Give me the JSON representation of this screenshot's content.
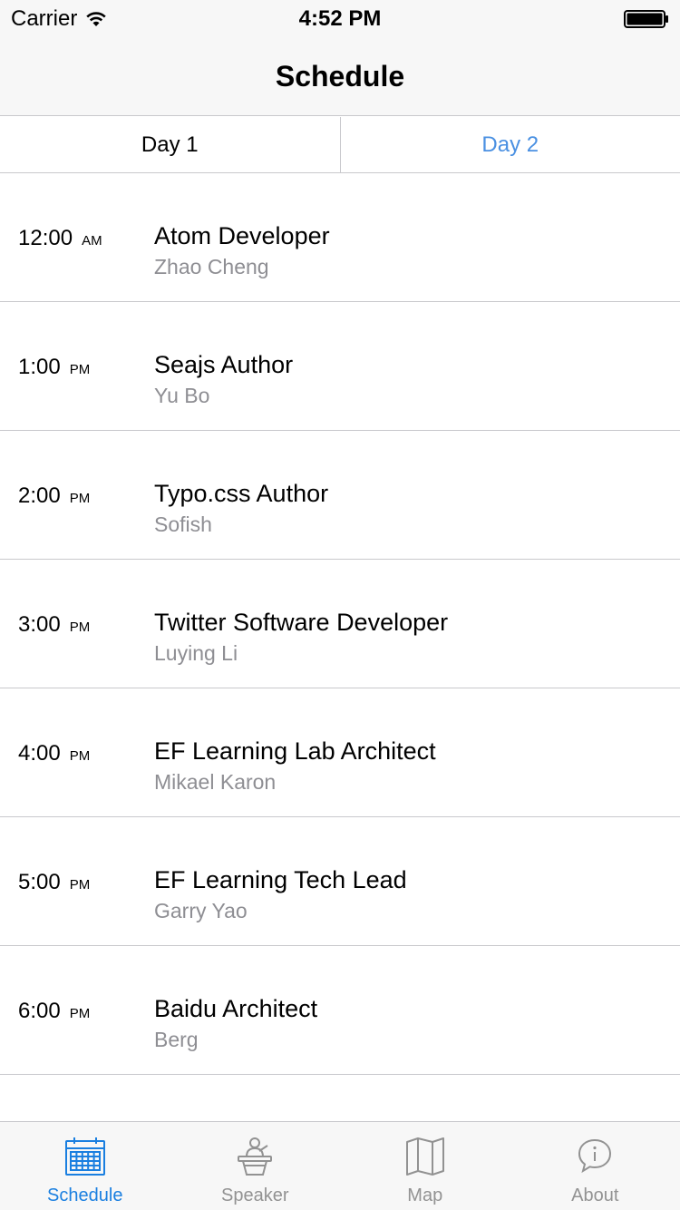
{
  "status": {
    "carrier": "Carrier",
    "time": "4:52 PM"
  },
  "nav": {
    "title": "Schedule"
  },
  "day_tabs": [
    {
      "label": "Day 1",
      "selected": true
    },
    {
      "label": "Day 2",
      "selected": false
    }
  ],
  "schedule": [
    {
      "time": "12:00",
      "period": "AM",
      "title": "Atom Developer",
      "speaker": "Zhao Cheng"
    },
    {
      "time": "1:00",
      "period": "PM",
      "title": "Seajs Author",
      "speaker": "Yu Bo"
    },
    {
      "time": "2:00",
      "period": "PM",
      "title": "Typo.css Author",
      "speaker": "Sofish"
    },
    {
      "time": "3:00",
      "period": "PM",
      "title": "Twitter Software Developer",
      "speaker": "Luying Li"
    },
    {
      "time": "4:00",
      "period": "PM",
      "title": "EF Learning Lab Architect",
      "speaker": "Mikael Karon"
    },
    {
      "time": "5:00",
      "period": "PM",
      "title": "EF Learning Tech Lead",
      "speaker": "Garry Yao"
    },
    {
      "time": "6:00",
      "period": "PM",
      "title": "Baidu Architect",
      "speaker": "Berg"
    }
  ],
  "tab_bar": [
    {
      "label": "Schedule",
      "icon": "calendar-icon",
      "active": true
    },
    {
      "label": "Speaker",
      "icon": "speaker-podium-icon",
      "active": false
    },
    {
      "label": "Map",
      "icon": "map-icon",
      "active": false
    },
    {
      "label": "About",
      "icon": "info-bubble-icon",
      "active": false
    }
  ],
  "colors": {
    "accent": "#1a7fe0",
    "day_tab_inactive": "#4a90e2",
    "secondary_text": "#8e8e93",
    "bar_bg": "#f7f7f7",
    "separator": "#c8c8cc"
  }
}
